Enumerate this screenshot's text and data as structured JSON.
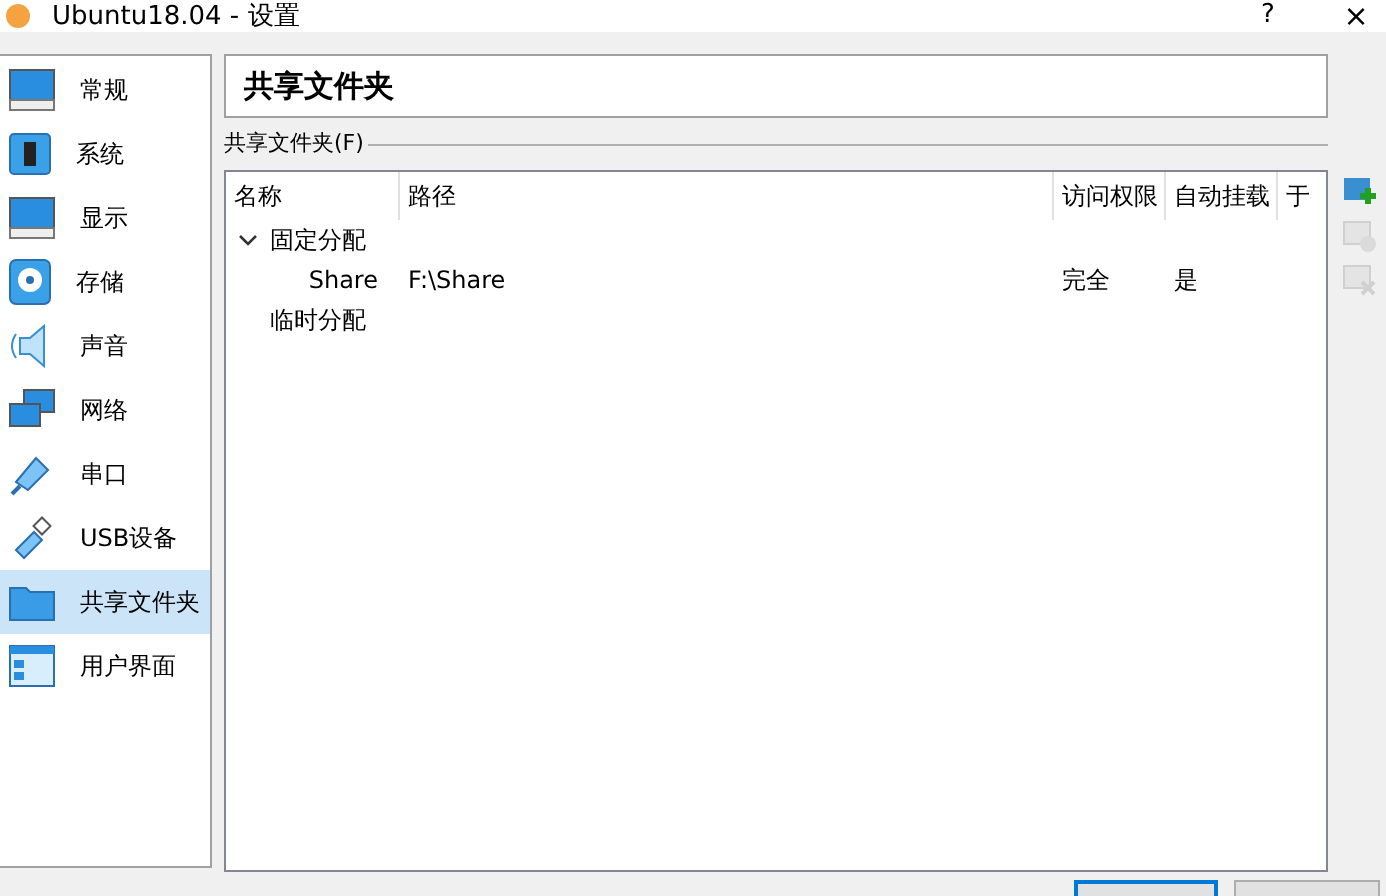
{
  "window": {
    "title": "Ubuntu18.04 - 设置",
    "help": "?",
    "close": "×"
  },
  "sidebar": {
    "items": [
      {
        "label": "常规",
        "selected": false
      },
      {
        "label": "系统",
        "selected": false
      },
      {
        "label": "显示",
        "selected": false
      },
      {
        "label": "存储",
        "selected": false
      },
      {
        "label": "声音",
        "selected": false
      },
      {
        "label": "网络",
        "selected": false
      },
      {
        "label": "串口",
        "selected": false
      },
      {
        "label": "USB设备",
        "selected": false
      },
      {
        "label": "共享文件夹",
        "selected": true
      },
      {
        "label": "用户界面",
        "selected": false
      }
    ]
  },
  "page_title": "共享文件夹",
  "group_label": "共享文件夹(F)",
  "table": {
    "columns": [
      "名称",
      "路径",
      "访问权限",
      "自动挂载",
      "于"
    ],
    "rows": [
      {
        "name": "固定分配",
        "expanded": true,
        "children": [
          {
            "name": "Share",
            "path": "F:\\Share",
            "access": "完全",
            "auto_mount": "是"
          }
        ]
      },
      {
        "name": "临时分配"
      }
    ]
  },
  "toolbar": [
    {
      "kind": "add",
      "disabled": false
    },
    {
      "kind": "edit",
      "disabled": true
    },
    {
      "kind": "remove",
      "disabled": true
    }
  ]
}
